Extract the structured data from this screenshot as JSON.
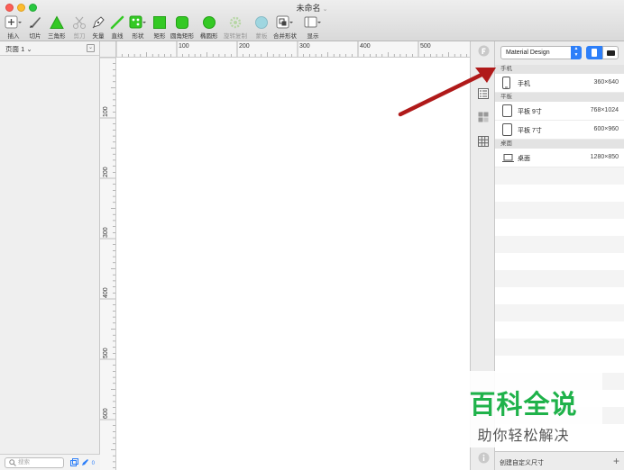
{
  "window": {
    "title": "未命名"
  },
  "toolbar": {
    "items": [
      {
        "label": "插入",
        "icon": "plus-icon",
        "enabled": true
      },
      {
        "label": "切片",
        "icon": "slice-knife-icon",
        "enabled": true
      },
      {
        "label": "三角形",
        "icon": "triangle-icon",
        "enabled": true
      },
      {
        "label": "剪刀",
        "icon": "scissors-icon",
        "enabled": false
      },
      {
        "label": "矢量",
        "icon": "vector-pen-icon",
        "enabled": true
      },
      {
        "label": "直线",
        "icon": "line-icon",
        "enabled": true
      },
      {
        "label": "形状",
        "icon": "shape-icon",
        "enabled": true
      },
      {
        "label": "矩形",
        "icon": "rectangle-icon",
        "enabled": true
      },
      {
        "label": "圆角矩形",
        "icon": "rounded-rectangle-icon",
        "enabled": true
      },
      {
        "label": "椭圆形",
        "icon": "ellipse-icon",
        "enabled": true
      },
      {
        "label": "旋转复制",
        "icon": "rotate-copy-icon",
        "enabled": false
      },
      {
        "label": "蒙板",
        "icon": "mask-icon",
        "enabled": false
      },
      {
        "label": "合并形状",
        "icon": "combine-shapes-icon",
        "enabled": true
      },
      {
        "label": "显示",
        "icon": "view-icon",
        "enabled": true
      }
    ]
  },
  "pages": {
    "current": "页面 1",
    "search_placeholder": "搜索"
  },
  "rulers": {
    "horizontal": [
      "100",
      "200",
      "300",
      "400",
      "500"
    ],
    "vertical": [
      "100",
      "200",
      "300",
      "400",
      "500",
      "600"
    ]
  },
  "inspector": {
    "preset": "Material Design",
    "groups": [
      {
        "name": "手机",
        "items": [
          {
            "name": "手机",
            "size": "360×640",
            "icon": "phone-icon"
          }
        ]
      },
      {
        "name": "平板",
        "items": [
          {
            "name": "平板 9寸",
            "size": "768×1024",
            "icon": "tablet-icon"
          },
          {
            "name": "平板 7寸",
            "size": "600×960",
            "icon": "tablet-icon"
          }
        ]
      },
      {
        "name": "桌面",
        "items": [
          {
            "name": "桌面",
            "size": "1280×850",
            "icon": "laptop-icon"
          }
        ]
      }
    ],
    "footer_label": "创建自定义尺寸"
  },
  "watermark": {
    "main": "百科全说",
    "sub": "助你轻松解决"
  },
  "colors": {
    "accent": "#2d7ff9",
    "shape_green": "#34c924",
    "arrow_red": "#b01a1a",
    "watermark_green": "#1fb24a"
  }
}
